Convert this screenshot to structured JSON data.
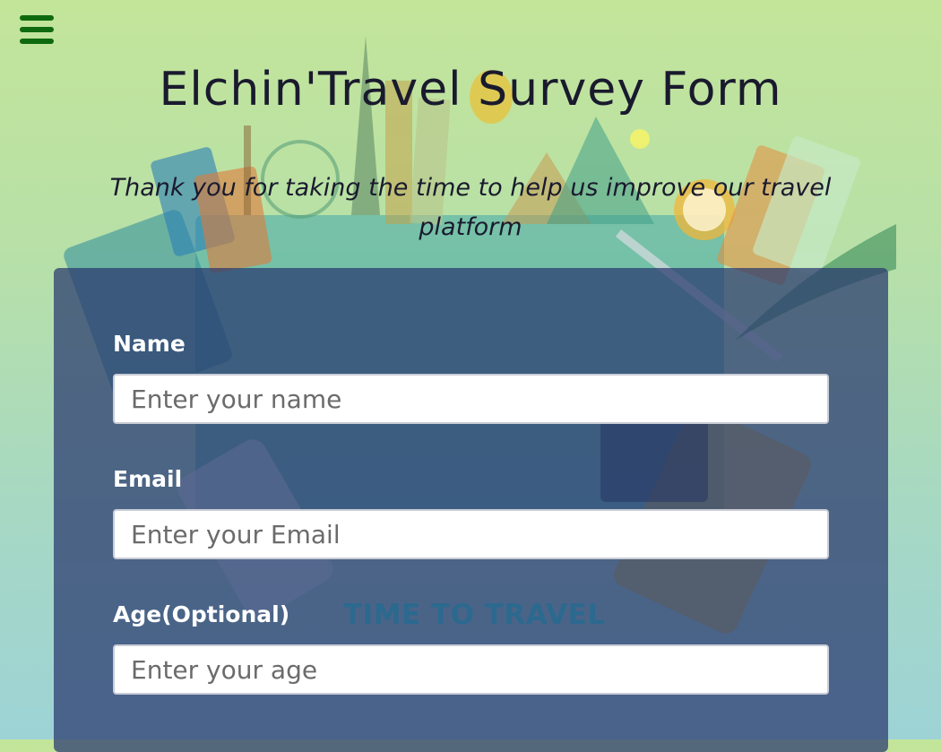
{
  "header": {
    "title": "Elchin'Travel Survey Form",
    "subtitle": "Thank you for taking the time to help us improve our travel platform",
    "menu_icon": "hamburger-menu-icon"
  },
  "background": {
    "art_text": "TIME TO TRAVEL"
  },
  "form": {
    "fields": [
      {
        "label": "Name",
        "placeholder": "Enter your name",
        "value": ""
      },
      {
        "label": "Email",
        "placeholder": "Enter your Email",
        "value": ""
      },
      {
        "label": "Age(Optional)",
        "placeholder": "Enter your age",
        "value": ""
      }
    ]
  },
  "colors": {
    "menu_icon": "#0f6a0f",
    "panel": "#28376e",
    "title": "#1a1a2e",
    "label": "#ffffff"
  }
}
